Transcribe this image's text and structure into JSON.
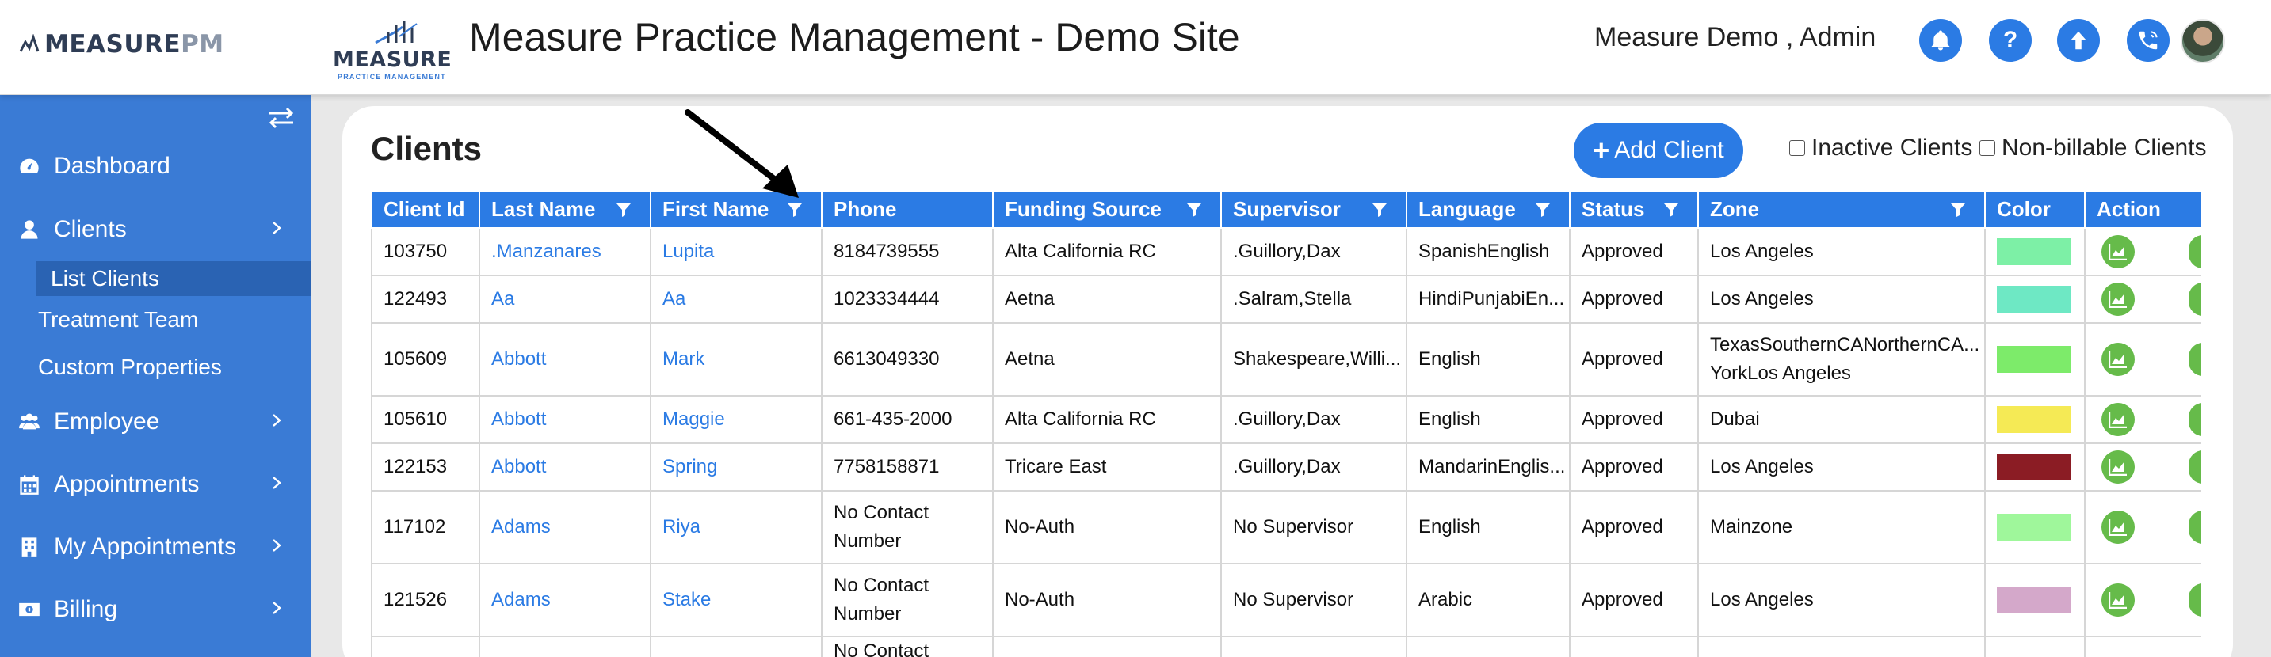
{
  "header": {
    "brand": "MEASUREPM",
    "brand_main": "MEASURE",
    "brand_suffix": "PM",
    "logo_word": "MEASURE",
    "logo_sub": "PRACTICE MANAGEMENT",
    "site_title": "Measure Practice Management - Demo Site",
    "user": "Measure Demo , Admin",
    "icons": [
      "bell-icon",
      "help-icon",
      "upload-icon",
      "phone-icon"
    ],
    "help_glyph": "?"
  },
  "sidebar": {
    "items": [
      {
        "label": "Dashboard",
        "icon": "dashboard-icon"
      },
      {
        "label": "Clients",
        "icon": "user-icon"
      },
      {
        "label": "List Clients"
      },
      {
        "label": "Treatment Team"
      },
      {
        "label": "Custom Properties"
      },
      {
        "label": "Employee",
        "icon": "users-icon"
      },
      {
        "label": "Appointments",
        "icon": "calendar-icon"
      },
      {
        "label": "My Appointments",
        "icon": "building-icon"
      },
      {
        "label": "Billing",
        "icon": "money-icon"
      }
    ]
  },
  "page": {
    "title": "Clients",
    "add_button": "Add Client",
    "inactive_label": "Inactive Clients",
    "nonbillable_label": "Non-billable Clients"
  },
  "table": {
    "columns": [
      "Client Id",
      "Last Name",
      "First Name",
      "Phone",
      "Funding Source",
      "Supervisor",
      "Language",
      "Status",
      "Zone",
      "Color",
      "Action"
    ],
    "rows": [
      {
        "id": "103750",
        "last": ".Manzanares",
        "first": "Lupita",
        "phone": "8184739555",
        "funding": "Alta California RC",
        "supervisor": ".Guillory,Dax",
        "language": "SpanishEnglish",
        "status": "Approved",
        "zone": "Los Angeles",
        "color": "#7df0a6"
      },
      {
        "id": "122493",
        "last": "Aa",
        "first": "Aa",
        "phone": "1023334444",
        "funding": "Aetna",
        "supervisor": ".Salram,Stella",
        "language": "HindiPunjabiEn...",
        "status": "Approved",
        "zone": "Los Angeles",
        "color": "#6ee8c4"
      },
      {
        "id": "105609",
        "last": "Abbott",
        "first": "Mark",
        "phone": "6613049330",
        "funding": "Aetna",
        "supervisor": "Shakespeare,Willi...",
        "language": "English",
        "status": "Approved",
        "zone": "TexasSouthernCANorthernCA... YorkLos Angeles",
        "color": "#7deb6a"
      },
      {
        "id": "105610",
        "last": "Abbott",
        "first": "Maggie",
        "phone": "661-435-2000",
        "funding": "Alta California RC",
        "supervisor": ".Guillory,Dax",
        "language": "English",
        "status": "Approved",
        "zone": "Dubai",
        "color": "#f5ea55"
      },
      {
        "id": "122153",
        "last": "Abbott",
        "first": "Spring",
        "phone": "7758158871",
        "funding": "Tricare East",
        "supervisor": ".Guillory,Dax",
        "language": "MandarinEnglis...",
        "status": "Approved",
        "zone": "Los Angeles",
        "color": "#8b1c24"
      },
      {
        "id": "117102",
        "last": "Adams",
        "first": "Riya",
        "phone": "No Contact Number",
        "funding": "No-Auth",
        "supervisor": "No Supervisor",
        "language": "English",
        "status": "Approved",
        "zone": "Mainzone",
        "color": "#9ff79b"
      },
      {
        "id": "121526",
        "last": "Adams",
        "first": "Stake",
        "phone": "No Contact Number",
        "funding": "No-Auth",
        "supervisor": "No Supervisor",
        "language": "Arabic",
        "status": "Approved",
        "zone": "Los Angeles",
        "color": "#d4a8ca"
      },
      {
        "id": "",
        "last": "",
        "first": "",
        "phone": "No Contact",
        "funding": "",
        "supervisor": "",
        "language": "",
        "status": "",
        "zone": "",
        "color": ""
      }
    ]
  }
}
